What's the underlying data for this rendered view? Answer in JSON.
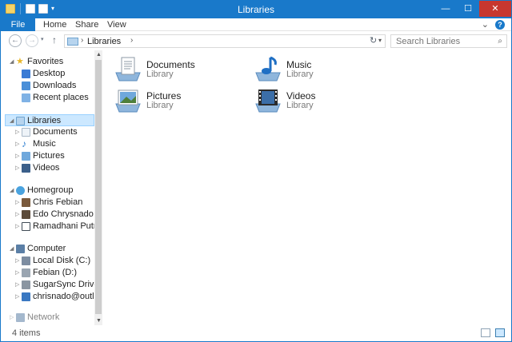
{
  "window": {
    "title": "Libraries",
    "controls": {
      "minimize": "—",
      "maximize": "☐",
      "close": "✕"
    }
  },
  "ribbon": {
    "tabs": [
      {
        "label": "File"
      },
      {
        "label": "Home"
      },
      {
        "label": "Share"
      },
      {
        "label": "View"
      }
    ],
    "expand_icon": "chevron-down-icon",
    "help_label": "?"
  },
  "address": {
    "back": "←",
    "forward": "→",
    "up": "↑",
    "path": [
      "Libraries"
    ],
    "search_placeholder": "Search Libraries"
  },
  "nav": {
    "favorites": {
      "label": "Favorites",
      "items": [
        {
          "label": "Desktop",
          "icon": "desktop-icon",
          "color": "#3a7bd5"
        },
        {
          "label": "Downloads",
          "icon": "downloads-icon",
          "color": "#4a8fd8"
        },
        {
          "label": "Recent places",
          "icon": "recent-places-icon",
          "color": "#7fb2e5"
        }
      ]
    },
    "libraries": {
      "label": "Libraries",
      "selected": true,
      "items": [
        {
          "label": "Documents",
          "icon": "documents-icon",
          "color": "#d9e6f3"
        },
        {
          "label": "Music",
          "icon": "music-icon",
          "color": "#2f7fd1"
        },
        {
          "label": "Pictures",
          "icon": "pictures-icon",
          "color": "#6fa8dc"
        },
        {
          "label": "Videos",
          "icon": "videos-icon",
          "color": "#3b5f8a"
        }
      ]
    },
    "homegroup": {
      "label": "Homegroup",
      "items": [
        {
          "label": "Chris Febian",
          "icon": "user-avatar-icon",
          "color": "#7a5a3c"
        },
        {
          "label": "Edo Chrysnado",
          "icon": "user-avatar-icon",
          "color": "#5c4b3a"
        },
        {
          "label": "Ramadhani Putra",
          "icon": "user-avatar-icon",
          "color": "#3f4a55"
        }
      ]
    },
    "computer": {
      "label": "Computer",
      "items": [
        {
          "label": "Local Disk (C:)",
          "icon": "local-disk-icon",
          "color": "#7d8da1"
        },
        {
          "label": "Febian (D:)",
          "icon": "drive-icon",
          "color": "#9aa5b1"
        },
        {
          "label": "SugarSync Drive (S:)",
          "icon": "network-drive-icon",
          "color": "#8a95a1"
        },
        {
          "label": "chrisnado@outlook.c",
          "icon": "cloud-drive-icon",
          "color": "#3a78c2"
        }
      ]
    },
    "network": {
      "label": "Network"
    }
  },
  "content": {
    "items": [
      {
        "name": "Documents",
        "type": "Library",
        "icon": "documents-library-icon"
      },
      {
        "name": "Music",
        "type": "Library",
        "icon": "music-library-icon"
      },
      {
        "name": "Pictures",
        "type": "Library",
        "icon": "pictures-library-icon"
      },
      {
        "name": "Videos",
        "type": "Library",
        "icon": "videos-library-icon"
      }
    ]
  },
  "status": {
    "item_count": "4 items"
  },
  "colors": {
    "accent": "#1979ca",
    "selection": "#cce8ff",
    "close": "#c7372f"
  }
}
